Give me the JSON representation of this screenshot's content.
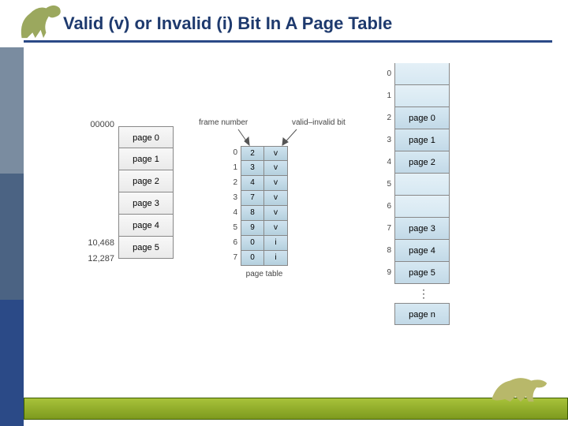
{
  "title": "Valid (v) or Invalid (i) Bit In A Page Table",
  "logical_mem": {
    "start_addr": "00000",
    "mid_addr": "10,468",
    "end_addr": "12,287",
    "pages": [
      "page 0",
      "page 1",
      "page 2",
      "page 3",
      "page 4",
      "page 5"
    ]
  },
  "page_table": {
    "label": "page table",
    "frame_header": "frame number",
    "valid_header": "valid–invalid bit",
    "rows": [
      {
        "idx": "0",
        "frame": "2",
        "bit": "v"
      },
      {
        "idx": "1",
        "frame": "3",
        "bit": "v"
      },
      {
        "idx": "2",
        "frame": "4",
        "bit": "v"
      },
      {
        "idx": "3",
        "frame": "7",
        "bit": "v"
      },
      {
        "idx": "4",
        "frame": "8",
        "bit": "v"
      },
      {
        "idx": "5",
        "frame": "9",
        "bit": "v"
      },
      {
        "idx": "6",
        "frame": "0",
        "bit": "i"
      },
      {
        "idx": "7",
        "frame": "0",
        "bit": "i"
      }
    ]
  },
  "phys_mem": {
    "frames": [
      {
        "idx": "0",
        "label": ""
      },
      {
        "idx": "1",
        "label": ""
      },
      {
        "idx": "2",
        "label": "page 0"
      },
      {
        "idx": "3",
        "label": "page 1"
      },
      {
        "idx": "4",
        "label": "page 2"
      },
      {
        "idx": "5",
        "label": ""
      },
      {
        "idx": "6",
        "label": ""
      },
      {
        "idx": "7",
        "label": "page 3"
      },
      {
        "idx": "8",
        "label": "page 4"
      },
      {
        "idx": "9",
        "label": "page 5"
      }
    ],
    "last": "page n"
  }
}
